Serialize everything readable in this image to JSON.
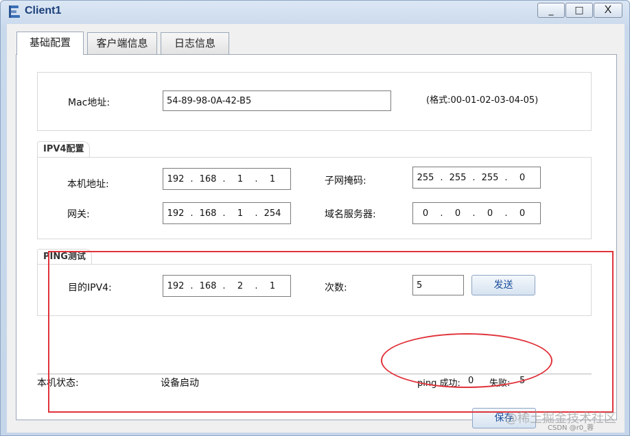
{
  "window": {
    "title": "Client1",
    "controls": {
      "minimize": "_",
      "maximize": "□",
      "close": "X"
    }
  },
  "tabs": [
    {
      "label": "基础配置",
      "active": true
    },
    {
      "label": "客户端信息",
      "active": false
    },
    {
      "label": "日志信息",
      "active": false
    }
  ],
  "mac": {
    "label": "Mac地址:",
    "value": "54-89-98-0A-42-B5",
    "format_hint": "(格式:00-01-02-03-04-05)"
  },
  "ipv4": {
    "legend": "IPV4配置",
    "local_ip": {
      "label": "本机地址:",
      "octets": [
        "192",
        "168",
        "1",
        "1"
      ]
    },
    "subnet_mask": {
      "label": "子网掩码:",
      "octets": [
        "255",
        "255",
        "255",
        "0"
      ]
    },
    "gateway": {
      "label": "网关:",
      "octets": [
        "192",
        "168",
        "1",
        "254"
      ]
    },
    "dns": {
      "label": "域名服务器:",
      "octets": [
        "0",
        "0",
        "0",
        "0"
      ]
    }
  },
  "ping": {
    "legend": "PING测试",
    "dest_label": "目的IPV4:",
    "dest_octets": [
      "192",
      "168",
      "2",
      "1"
    ],
    "count_label": "次数:",
    "count_value": "5",
    "send_button": "发送"
  },
  "status": {
    "label": "本机状态:",
    "value": "设备启动",
    "ping_success_label": "ping 成功:",
    "ping_success_value": "0",
    "fail_label": "失败:",
    "fail_value": "5"
  },
  "save_button": "保存",
  "watermark": {
    "line1": "@稀土掘金技术社区",
    "line2": "CSDN @r0_蓉"
  },
  "colors": {
    "annotation": "#e0323a",
    "title_text": "#1b3f7a",
    "button_text": "#1a4d9c"
  }
}
